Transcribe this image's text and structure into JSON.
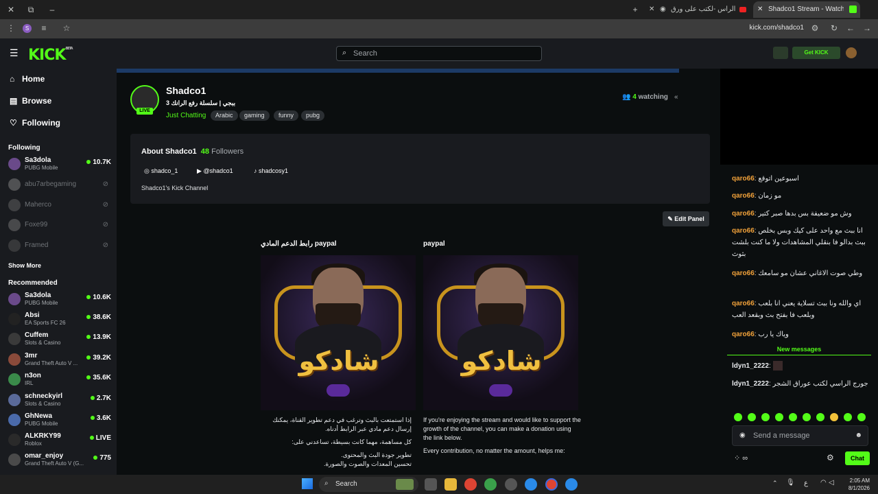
{
  "browser": {
    "tabs": [
      {
        "title": "جورج الراس -لكتب على ورق"
      },
      {
        "title": "Shadco1 Stream - Watch Live o"
      }
    ],
    "url": "kick.com/shadco1",
    "profile_initial": "S"
  },
  "kick": {
    "logo": "KICK",
    "logo_badge": "BETA",
    "search_placeholder": "Search",
    "get_kick": "Get KICK"
  },
  "sidebar": {
    "nav": [
      {
        "label": "Home"
      },
      {
        "label": "Browse"
      },
      {
        "label": "Following"
      }
    ],
    "following_title": "Following",
    "following": [
      {
        "name": "Sa3dola",
        "category": "PUBG Mobile",
        "viewers": "10.7K",
        "live": true
      },
      {
        "name": "abu7arbegaming",
        "live": false
      },
      {
        "name": "Maherco",
        "live": false
      },
      {
        "name": "Foxe99",
        "live": false
      },
      {
        "name": "Framed",
        "live": false
      }
    ],
    "show_more": "Show More",
    "recommended_title": "Recommended",
    "recommended": [
      {
        "name": "Sa3dola",
        "category": "PUBG Mobile",
        "viewers": "10.6K"
      },
      {
        "name": "Absi",
        "category": "EA Sports FC 26",
        "viewers": "38.6K"
      },
      {
        "name": "Cuffem",
        "category": "Slots & Casino",
        "viewers": "13.9K"
      },
      {
        "name": "3mr",
        "category": "Grand Theft Auto V ...",
        "viewers": "39.2K"
      },
      {
        "name": "n3on",
        "category": "IRL",
        "viewers": "35.6K"
      },
      {
        "name": "schneckyirl",
        "category": "Slots & Casino",
        "viewers": "2.7K"
      },
      {
        "name": "GhNewa",
        "category": "PUBG Mobile",
        "viewers": "3.6K"
      },
      {
        "name": "ALKRKY99",
        "category": "Roblox",
        "viewers": "LIVE"
      },
      {
        "name": "omar_enjoy",
        "category": "Grand Theft Auto V (G...",
        "viewers": "775"
      }
    ]
  },
  "channel": {
    "name": "Shadco1",
    "live_badge": "LIVE",
    "title": "ببجي | سلسلة رفع الرانك 3",
    "category": "Just Chatting",
    "tags": [
      "Arabic",
      "gaming",
      "funny",
      "pubg"
    ],
    "watching_count": "4",
    "watching_label": "watching"
  },
  "about": {
    "title": "About Shadco1",
    "followers_count": "48",
    "followers_label": "Followers",
    "socials": [
      {
        "handle": "shadco_1"
      },
      {
        "handle": "@shadco1"
      },
      {
        "handle": "shadcosy1"
      }
    ],
    "description": "Shadco1's Kick Channel"
  },
  "edit_panel": "Edit Panel",
  "panels": [
    {
      "title": "رابط الدعم المادي paypal",
      "logo_text": "شادكو",
      "lines": [
        "إذا استمتعت بالبث وترغب في دعم تطوير القناة، يمكنك إرسال دعم مادي عبر الرابط أدناه.",
        "كل مساهمة، مهما كانت بسيطة، تساعدني على:",
        "تطوير جودة البث والمحتوى.",
        "تحسين المعدات والصوت والصورة."
      ]
    },
    {
      "title": "paypal",
      "logo_text": "شادكو",
      "lines": [
        "If you're enjoying the stream and would like to support the growth of the channel, you can make a donation using the link below.",
        "Every contribution, no matter the amount, helps me:"
      ]
    }
  ],
  "chat": {
    "messages": [
      {
        "user": "qaro66",
        "text": "اسبوعين اتوقع"
      },
      {
        "user": "qaro66",
        "text": "مو زمان"
      },
      {
        "user": "qaro66",
        "text": "وش مو ضعيفة بس بدها صبر كتير"
      },
      {
        "user": "qaro66",
        "text": "انا ببث مع واحد على كيك وبس بخلص ببث بدالو فا بنقلي المشاهدات ولا ما كنت بلشت بثوث"
      },
      {
        "user": "qaro66",
        "text": "وطي صوت الاغاني عشان مو سامعك"
      },
      {
        "user": "qaro66",
        "text": "اي والله ونا ببث تسلاية يعني انا بلعب وبلعب فا بفتح بث وبقعد العب"
      },
      {
        "user": "qaro66",
        "text": "وياك يا رب"
      }
    ],
    "new_messages": "New messages",
    "new": [
      {
        "user": "ldyn1_2222",
        "text": ""
      },
      {
        "user": "ldyn1_2222",
        "text": "جورج الراسي لكتب عوراق الشجر"
      }
    ],
    "input_placeholder": "Send a message",
    "send_label": "Chat",
    "reply_count": "∞"
  },
  "taskbar": {
    "search_placeholder": "Search",
    "time": "2:05 AM",
    "date": "8/1/2026",
    "lang": "ع"
  },
  "colors": {
    "accent": "#53fc18",
    "chat_user": "#f2a23a"
  }
}
